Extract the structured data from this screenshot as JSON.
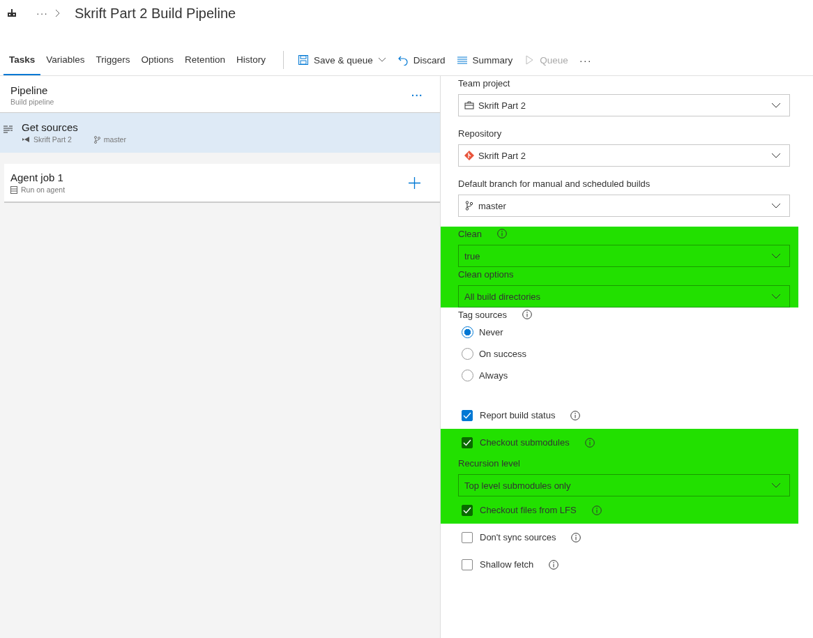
{
  "header": {
    "breadcrumb_more": "···",
    "title": "Skrift Part 2 Build Pipeline"
  },
  "tabs": [
    {
      "label": "Tasks",
      "selected": true
    },
    {
      "label": "Variables",
      "selected": false
    },
    {
      "label": "Triggers",
      "selected": false
    },
    {
      "label": "Options",
      "selected": false
    },
    {
      "label": "Retention",
      "selected": false
    },
    {
      "label": "History",
      "selected": false
    }
  ],
  "toolbar": [
    {
      "kind": "save",
      "label": "Save & queue",
      "disabled": false
    },
    {
      "kind": "discard",
      "label": "Discard",
      "disabled": false
    },
    {
      "kind": "summary",
      "label": "Summary",
      "disabled": false
    },
    {
      "kind": "queue",
      "label": "Queue",
      "disabled": true
    }
  ],
  "toolbar_more": "···",
  "pipeline": {
    "title": "Pipeline",
    "subtitle": "Build pipeline",
    "more": "···"
  },
  "get_sources": {
    "title": "Get sources",
    "repo": "Skrift Part 2",
    "branch": "master",
    "selected": true
  },
  "agent_job": {
    "title": "Agent job 1",
    "subtitle": "Run on agent"
  },
  "settings": [
    {
      "kind": "select",
      "label": "Team project",
      "value": "Skrift Part 2",
      "info": false,
      "highlighted": false
    },
    {
      "kind": "select",
      "label": "Repository",
      "value": "Skrift Part 2",
      "info": false,
      "highlighted": false
    },
    {
      "kind": "select",
      "label": "Default branch for manual and scheduled builds",
      "value": "master",
      "info": false,
      "highlighted": false
    },
    {
      "kind": "select",
      "label": "Clean",
      "value": "true",
      "info": true,
      "highlighted": true
    },
    {
      "kind": "select",
      "label": "Clean options",
      "value": "All build directories",
      "info": false,
      "highlighted": true
    },
    {
      "kind": "radio",
      "label": "Tag sources",
      "info": true,
      "highlighted": false,
      "options": [
        {
          "label": "Never",
          "selected": true
        },
        {
          "label": "On success",
          "selected": false
        },
        {
          "label": "Always",
          "selected": false
        }
      ]
    },
    {
      "kind": "checkbox",
      "label": "Report build status",
      "checked": true,
      "info": true,
      "highlighted": false
    },
    {
      "kind": "checkbox",
      "label": "Checkout submodules",
      "checked": true,
      "info": true,
      "highlighted": true
    },
    {
      "kind": "select",
      "label": "Recursion level",
      "value": "Top level submodules only",
      "info": false,
      "highlighted": true
    },
    {
      "kind": "checkbox",
      "label": "Checkout files from LFS",
      "checked": true,
      "info": true,
      "highlighted": true
    },
    {
      "kind": "checkbox",
      "label": "Don't sync sources",
      "checked": false,
      "info": true,
      "highlighted": false
    },
    {
      "kind": "checkbox",
      "label": "Shallow fetch",
      "checked": false,
      "info": true,
      "highlighted": false
    }
  ]
}
